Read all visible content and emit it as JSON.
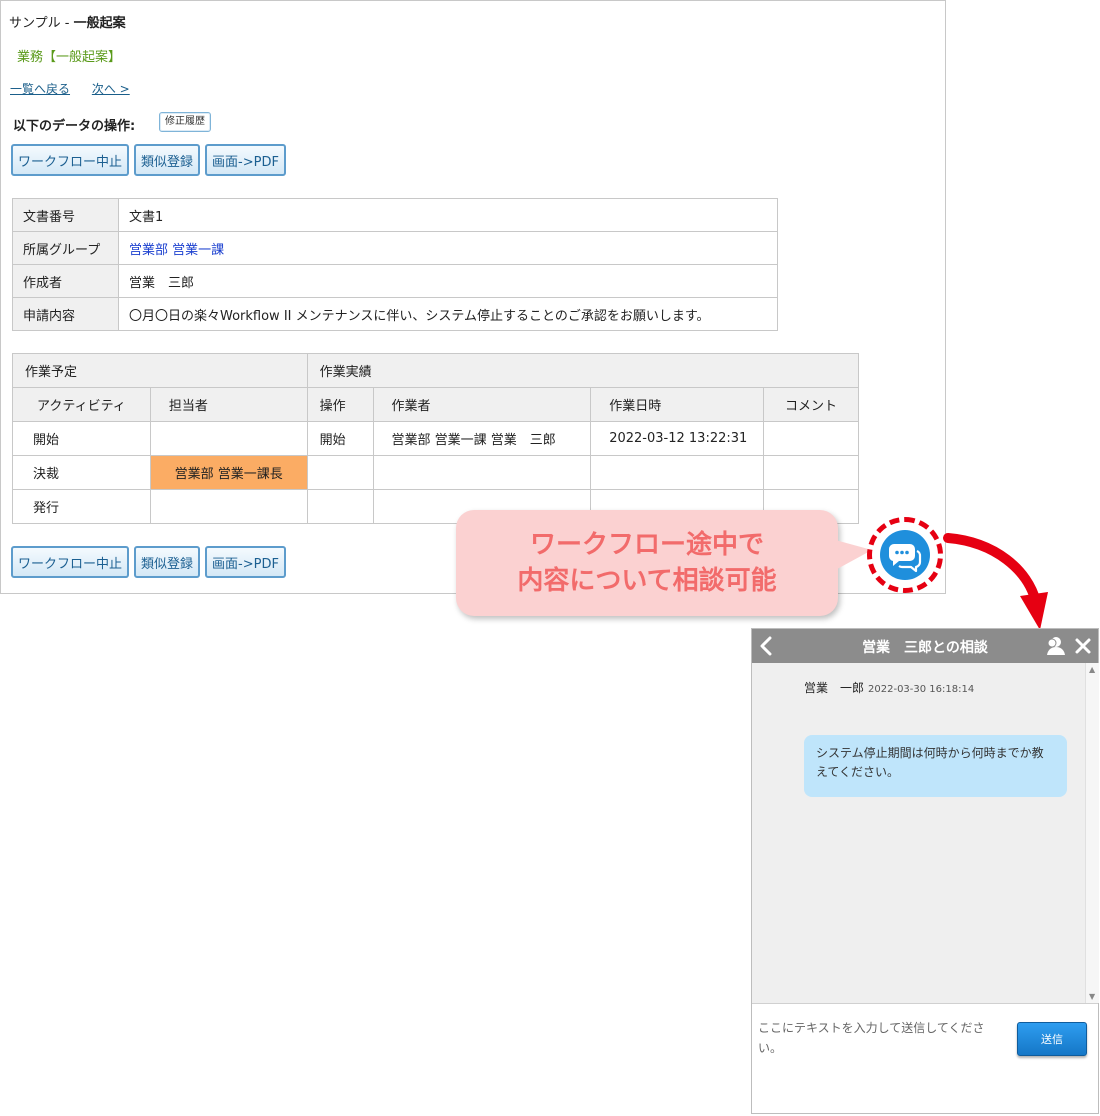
{
  "page": {
    "title_prefix": "サンプル - ",
    "title_main": "一般起案",
    "subtitle": "業務【一般起案】",
    "nav": {
      "back": "一覧へ戻る",
      "next": "次へ >"
    },
    "ops_label": "以下のデータの操作:",
    "history_button": "修正履歴",
    "buttons": {
      "stop": "ワークフロー中止",
      "similar": "類似登録",
      "pdf": "画面->PDF"
    }
  },
  "info": {
    "rows": [
      {
        "label": "文書番号",
        "value": "文書1"
      },
      {
        "label": "所属グループ",
        "value": "営業部 営業一課"
      },
      {
        "label": "作成者",
        "value": "営業　三郎"
      },
      {
        "label": "申請内容",
        "value": "〇月〇日の楽々Workflow II メンテナンスに伴い、システム停止することのご承認をお願いします。"
      }
    ]
  },
  "tasks": {
    "group_planned": "作業予定",
    "group_actual": "作業実績",
    "headers": [
      "アクティビティ",
      "担当者",
      "操作",
      "作業者",
      "作業日時",
      "コメント"
    ],
    "rows": [
      {
        "activity": "開始",
        "assignee": "",
        "operation": "開始",
        "worker": "営業部 営業一課 営業　三郎",
        "datetime": "2022-03-12 13:22:31",
        "comment": ""
      },
      {
        "activity": "決裁",
        "assignee": "営業部 営業一課長",
        "operation": "",
        "worker": "",
        "datetime": "",
        "comment": ""
      },
      {
        "activity": "発行",
        "assignee": "",
        "operation": "",
        "worker": "",
        "datetime": "",
        "comment": ""
      }
    ],
    "highlight_color": "#fbac64"
  },
  "callout": {
    "line1": "ワークフロー途中で",
    "line2": "内容について相談可能"
  },
  "chat": {
    "title": "営業　三郎との相談",
    "message": {
      "sender": "営業　一郎",
      "time": "2022-03-30 16:18:14",
      "text": "システム停止期間は何時から何時までか教えてください。"
    },
    "input_placeholder": "ここにテキストを入力して送信してください。",
    "send_label": "送信"
  },
  "colors": {
    "accent": "#1f8fdc",
    "alert": "#e60012",
    "bubble": "#bfe5fb",
    "callout": "#fbd1d1"
  }
}
